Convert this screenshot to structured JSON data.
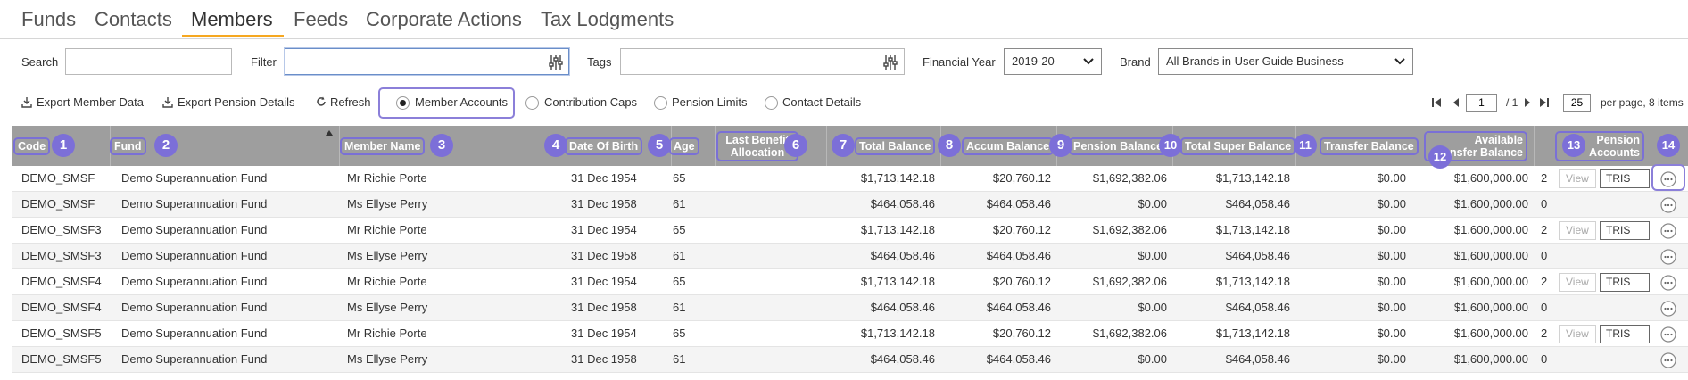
{
  "nav": {
    "tabs": [
      "Funds",
      "Contacts",
      "Members",
      "Feeds",
      "Corporate Actions",
      "Tax Lodgments"
    ],
    "active": "Members"
  },
  "filters": {
    "search_label": "Search",
    "search_value": "",
    "filter_label": "Filter",
    "filter_value": "",
    "tags_label": "Tags",
    "tags_value": "",
    "financial_year_label": "Financial Year",
    "financial_year_value": "2019-20",
    "brand_label": "Brand",
    "brand_value": "All Brands in User Guide Business"
  },
  "toolbar": {
    "export_member_data": "Export Member Data",
    "export_pension_details": "Export Pension Details",
    "refresh": "Refresh",
    "views": [
      {
        "label": "Member Accounts",
        "selected": true
      },
      {
        "label": "Contribution Caps",
        "selected": false
      },
      {
        "label": "Pension Limits",
        "selected": false
      },
      {
        "label": "Contact Details",
        "selected": false
      }
    ]
  },
  "pager": {
    "page": "1",
    "of": "/ 1",
    "per_page": "25",
    "per_page_suffix": "per page, 8 items"
  },
  "grid": {
    "columns": [
      {
        "label": "Code",
        "badge": "1"
      },
      {
        "label": "Fund",
        "badge": "2"
      },
      {
        "label": "Member Name",
        "badge": "3"
      },
      {
        "label": "Date Of Birth",
        "badge": "4"
      },
      {
        "label": "Age",
        "badge": "5"
      },
      {
        "label": "Last Benefit Allocation",
        "badge": "6"
      },
      {
        "label": "Total Balance",
        "badge": "7"
      },
      {
        "label": "Accum Balance",
        "badge": "8"
      },
      {
        "label": "Pension Balance",
        "badge": "9"
      },
      {
        "label": "Total Super Balance",
        "badge": "10"
      },
      {
        "label": "Transfer Balance",
        "badge": "11"
      },
      {
        "label": "Available Transfer Balance",
        "badge": "12"
      },
      {
        "label": "Pension Accounts",
        "badge": "13"
      },
      {
        "label": "",
        "badge": "14"
      }
    ],
    "rows": [
      {
        "code": "DEMO_SMSF",
        "fund": "Demo Superannuation Fund",
        "member": "Mr Richie Porte",
        "dob": "31 Dec 1954",
        "age": "65",
        "last_benefit": "",
        "total": "$1,713,142.18",
        "accum": "$20,760.12",
        "pension": "$1,692,382.06",
        "total_super": "$1,713,142.18",
        "transfer": "$0.00",
        "available": "$1,600,000.00",
        "pension_accounts": "2",
        "view_label": "View",
        "tris_label": "TRIS Co"
      },
      {
        "code": "DEMO_SMSF",
        "fund": "Demo Superannuation Fund",
        "member": "Ms Ellyse Perry",
        "dob": "31 Dec 1958",
        "age": "61",
        "last_benefit": "",
        "total": "$464,058.46",
        "accum": "$464,058.46",
        "pension": "$0.00",
        "total_super": "$464,058.46",
        "transfer": "$0.00",
        "available": "$1,600,000.00",
        "pension_accounts": "0",
        "view_label": "",
        "tris_label": ""
      },
      {
        "code": "DEMO_SMSF3",
        "fund": "Demo Superannuation Fund",
        "member": "Mr Richie Porte",
        "dob": "31 Dec 1954",
        "age": "65",
        "last_benefit": "",
        "total": "$1,713,142.18",
        "accum": "$20,760.12",
        "pension": "$1,692,382.06",
        "total_super": "$1,713,142.18",
        "transfer": "$0.00",
        "available": "$1,600,000.00",
        "pension_accounts": "2",
        "view_label": "View",
        "tris_label": "TRIS Co"
      },
      {
        "code": "DEMO_SMSF3",
        "fund": "Demo Superannuation Fund",
        "member": "Ms Ellyse Perry",
        "dob": "31 Dec 1958",
        "age": "61",
        "last_benefit": "",
        "total": "$464,058.46",
        "accum": "$464,058.46",
        "pension": "$0.00",
        "total_super": "$464,058.46",
        "transfer": "$0.00",
        "available": "$1,600,000.00",
        "pension_accounts": "0",
        "view_label": "",
        "tris_label": ""
      },
      {
        "code": "DEMO_SMSF4",
        "fund": "Demo Superannuation Fund",
        "member": "Mr Richie Porte",
        "dob": "31 Dec 1954",
        "age": "65",
        "last_benefit": "",
        "total": "$1,713,142.18",
        "accum": "$20,760.12",
        "pension": "$1,692,382.06",
        "total_super": "$1,713,142.18",
        "transfer": "$0.00",
        "available": "$1,600,000.00",
        "pension_accounts": "2",
        "view_label": "View",
        "tris_label": "TRIS Co"
      },
      {
        "code": "DEMO_SMSF4",
        "fund": "Demo Superannuation Fund",
        "member": "Ms Ellyse Perry",
        "dob": "31 Dec 1958",
        "age": "61",
        "last_benefit": "",
        "total": "$464,058.46",
        "accum": "$464,058.46",
        "pension": "$0.00",
        "total_super": "$464,058.46",
        "transfer": "$0.00",
        "available": "$1,600,000.00",
        "pension_accounts": "0",
        "view_label": "",
        "tris_label": ""
      },
      {
        "code": "DEMO_SMSF5",
        "fund": "Demo Superannuation Fund",
        "member": "Mr Richie Porte",
        "dob": "31 Dec 1954",
        "age": "65",
        "last_benefit": "",
        "total": "$1,713,142.18",
        "accum": "$20,760.12",
        "pension": "$1,692,382.06",
        "total_super": "$1,713,142.18",
        "transfer": "$0.00",
        "available": "$1,600,000.00",
        "pension_accounts": "2",
        "view_label": "View",
        "tris_label": "TRIS Co"
      },
      {
        "code": "DEMO_SMSF5",
        "fund": "Demo Superannuation Fund",
        "member": "Ms Ellyse Perry",
        "dob": "31 Dec 1958",
        "age": "61",
        "last_benefit": "",
        "total": "$464,058.46",
        "accum": "$464,058.46",
        "pension": "$0.00",
        "total_super": "$464,058.46",
        "transfer": "$0.00",
        "available": "$1,600,000.00",
        "pension_accounts": "0",
        "view_label": "",
        "tris_label": ""
      }
    ]
  },
  "colors": {
    "accent_tab": "#f6a821",
    "annotation": "#7c6fd8",
    "header_bg": "#9e9e9e"
  },
  "icons": {
    "filter_builder": "sliders-icon",
    "export": "download-icon",
    "refresh": "refresh-icon",
    "row_actions": "more-options-icon"
  }
}
